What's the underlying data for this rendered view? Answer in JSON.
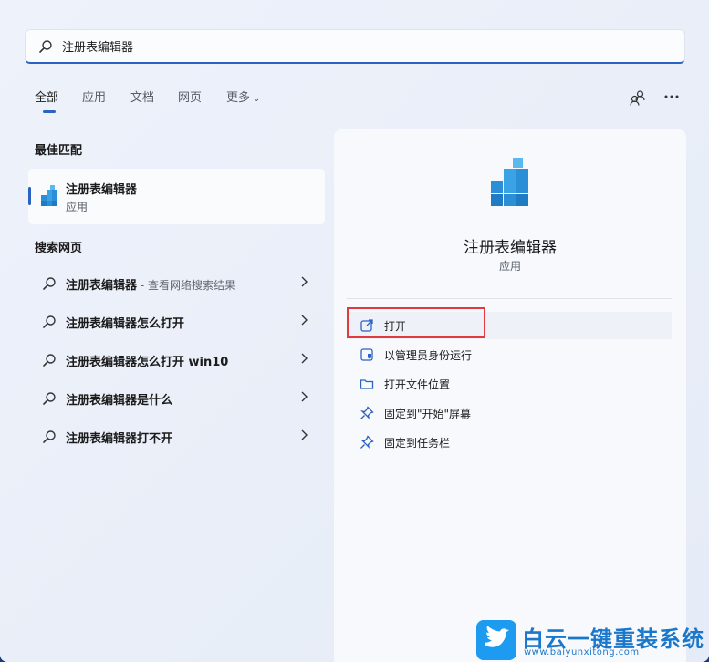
{
  "search": {
    "value": "注册表编辑器"
  },
  "tabs": [
    {
      "label": "全部"
    },
    {
      "label": "应用"
    },
    {
      "label": "文档"
    },
    {
      "label": "网页"
    },
    {
      "label": "更多"
    }
  ],
  "colors": {
    "accent": "#2b63c2",
    "highlight": "#e0393e",
    "watermark": "#1a77c9"
  },
  "best_match": {
    "title": "最佳匹配",
    "name": "注册表编辑器",
    "type": "应用"
  },
  "web": {
    "title": "搜索网页",
    "items": [
      {
        "label": "注册表编辑器",
        "suffix": " - 查看网络搜索结果"
      },
      {
        "label": "注册表编辑器怎么打开",
        "suffix": ""
      },
      {
        "label": "注册表编辑器怎么打开 win10",
        "suffix": ""
      },
      {
        "label": "注册表编辑器是什么",
        "suffix": ""
      },
      {
        "label": "注册表编辑器打不开",
        "suffix": ""
      }
    ]
  },
  "detail": {
    "name": "注册表编辑器",
    "type": "应用",
    "actions": [
      {
        "label": "打开",
        "icon": "open-external-icon"
      },
      {
        "label": "以管理员身份运行",
        "icon": "shield-icon"
      },
      {
        "label": "打开文件位置",
        "icon": "folder-icon"
      },
      {
        "label": "固定到\"开始\"屏幕",
        "icon": "pin-icon"
      },
      {
        "label": "固定到任务栏",
        "icon": "pin-icon"
      }
    ]
  },
  "watermark": {
    "title": "白云一键重装系统",
    "url": "www.baiyunxitong.com"
  }
}
